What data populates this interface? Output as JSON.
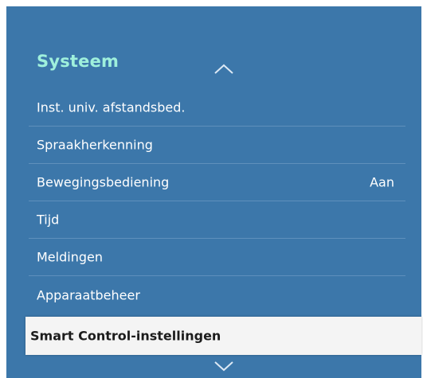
{
  "menu": {
    "title": "Systeem",
    "items": [
      {
        "label": "Inst. univ. afstandsbed.",
        "value": ""
      },
      {
        "label": "Spraakherkenning",
        "value": ""
      },
      {
        "label": "Bewegingsbediening",
        "value": "Aan"
      },
      {
        "label": "Tijd",
        "value": ""
      },
      {
        "label": "Meldingen",
        "value": ""
      },
      {
        "label": "Apparaatbeheer",
        "value": ""
      }
    ],
    "selected_item": {
      "label": "Smart Control-instellingen"
    }
  },
  "icons": {
    "scroll_up": "chevron-up-icon",
    "scroll_down": "chevron-down-icon"
  },
  "colors": {
    "panel_background": "#3c77aa",
    "title": "#9ff0dc",
    "item_text": "#ffffff",
    "divider": "#5f90bc",
    "selected_background": "#f4f4f4",
    "selected_text": "#1c1c1c"
  }
}
